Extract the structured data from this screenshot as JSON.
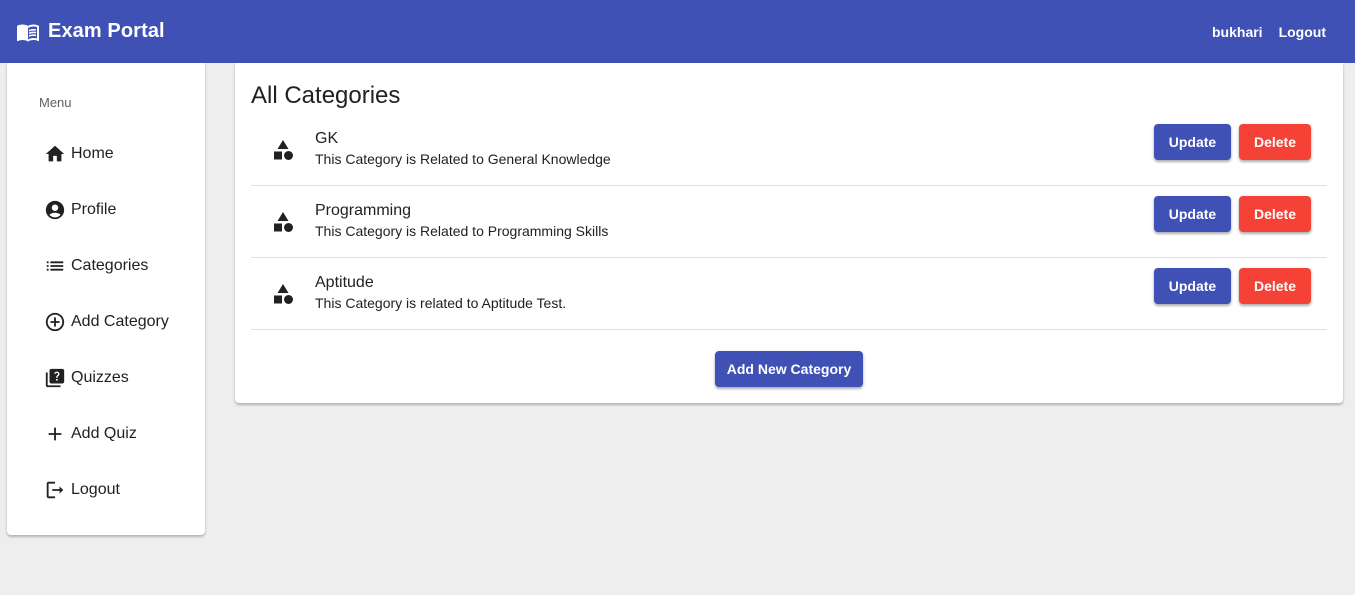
{
  "app": {
    "title": "Exam Portal",
    "brand_icon": "menu-book-icon",
    "user": "bukhari",
    "logout_label": "Logout",
    "colors": {
      "primary": "#3f51b5",
      "warn": "#f44336",
      "background": "#eeeeee"
    }
  },
  "sidebar": {
    "title": "Menu",
    "items": [
      {
        "label": "Home",
        "icon": "home-icon"
      },
      {
        "label": "Profile",
        "icon": "account-circle-icon"
      },
      {
        "label": "Categories",
        "icon": "list-icon"
      },
      {
        "label": "Add Category",
        "icon": "add-circle-outline-icon"
      },
      {
        "label": "Quizzes",
        "icon": "quiz-icon"
      },
      {
        "label": "Add Quiz",
        "icon": "add-icon"
      },
      {
        "label": "Logout",
        "icon": "logout-icon"
      }
    ]
  },
  "main": {
    "title": "All Categories",
    "category_icon": "category-icon",
    "categories": [
      {
        "name": "GK",
        "description": "This Category is Related to General Knowledge"
      },
      {
        "name": "Programming",
        "description": "This Category is Related to Programming Skills"
      },
      {
        "name": "Aptitude",
        "description": "This Category is related to Aptitude Test."
      }
    ],
    "update_label": "Update",
    "delete_label": "Delete",
    "add_new_label": "Add New Category"
  }
}
